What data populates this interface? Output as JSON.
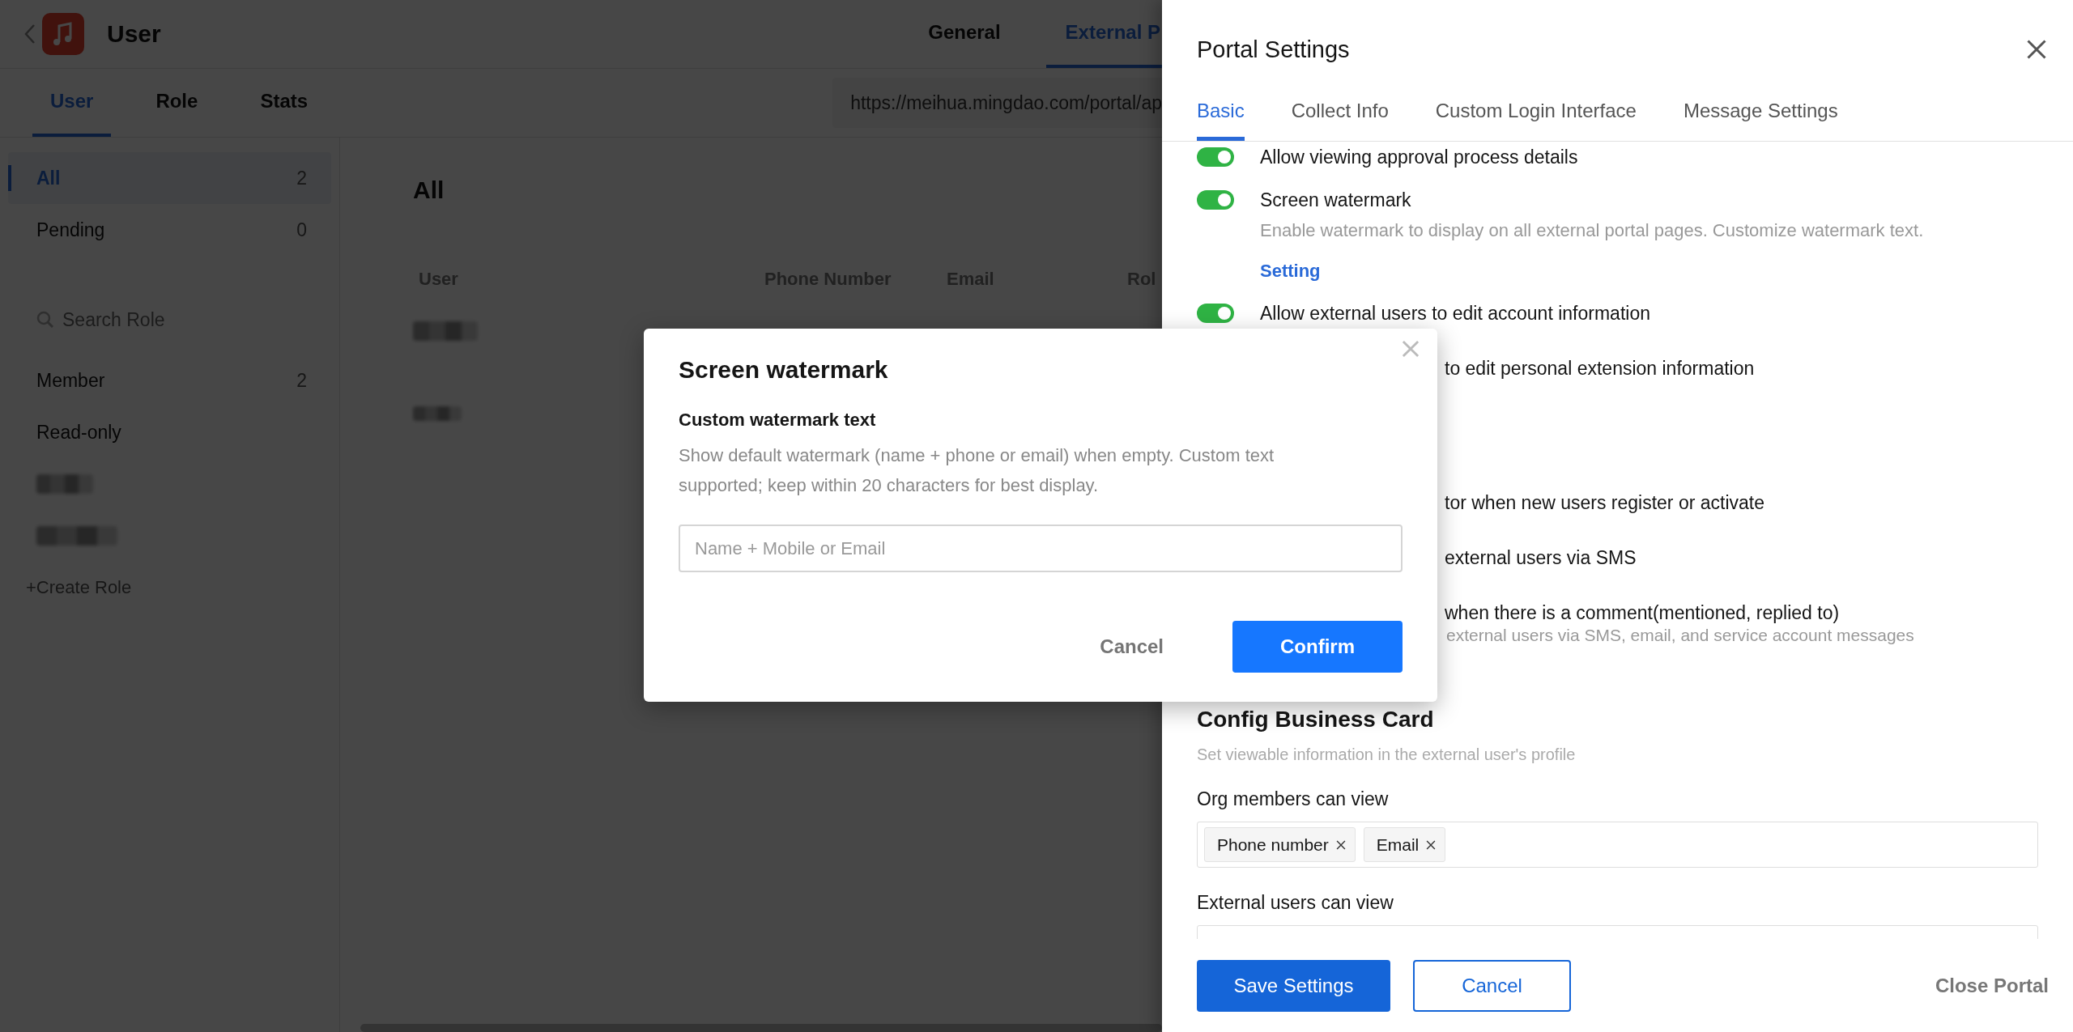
{
  "app": {
    "title": "User",
    "top_tabs": [
      {
        "label": "General",
        "selected": false
      },
      {
        "label": "External P",
        "selected": true
      }
    ],
    "sub_tabs": [
      {
        "label": "User",
        "selected": true
      },
      {
        "label": "Role",
        "selected": false
      },
      {
        "label": "Stats",
        "selected": false
      }
    ],
    "portal_url": "https://meihua.mingdao.com/portal/ap",
    "sidebar": {
      "filters": [
        {
          "label": "All",
          "count": "2",
          "selected": true
        },
        {
          "label": "Pending",
          "count": "0",
          "selected": false
        }
      ],
      "search": {
        "placeholder": "Search Role"
      },
      "roles": [
        {
          "kind": "text",
          "label": "Member",
          "count": "2"
        },
        {
          "kind": "text",
          "label": "Read-only"
        },
        {
          "kind": "redacted"
        },
        {
          "kind": "redacted"
        }
      ],
      "create_role": "+Create Role"
    },
    "main": {
      "heading": "All",
      "columns": [
        "User",
        "Phone Number",
        "Email",
        "Rol"
      ],
      "rows": [
        {
          "kind": "redacted"
        },
        {
          "kind": "redacted"
        }
      ]
    }
  },
  "drawer": {
    "title": "Portal Settings",
    "tabs": [
      {
        "label": "Basic",
        "selected": true
      },
      {
        "label": "Collect Info",
        "selected": false
      },
      {
        "label": "Custom Login Interface",
        "selected": false
      },
      {
        "label": "Message Settings",
        "selected": false
      }
    ],
    "settings": [
      {
        "kind": "toggle",
        "label": "Allow viewing approval process details",
        "on": true
      },
      {
        "kind": "toggle",
        "label": "Screen watermark",
        "on": true,
        "description": "Enable watermark to display on all external portal pages. Customize watermark text.",
        "link": "Setting"
      },
      {
        "kind": "toggle",
        "label": "Allow external users to edit account information",
        "on": true
      },
      {
        "kind": "partial",
        "label": "to edit personal extension information"
      },
      {
        "kind": "partial",
        "label": "tor when new users register or activate"
      },
      {
        "kind": "partial",
        "label": "external users via SMS"
      },
      {
        "kind": "partial",
        "label": "when there is a comment(mentioned, replied to)",
        "description": "external users via SMS, email, and service account messages"
      }
    ],
    "business_card": {
      "title": "Config Business Card",
      "subtitle": "Set viewable information in the external user's profile",
      "fields": [
        {
          "label": "Org members can view",
          "tags": [
            "Phone number",
            "Email"
          ]
        },
        {
          "label": "External users can view"
        }
      ]
    },
    "buttons": {
      "save": "Save Settings",
      "cancel": "Cancel",
      "close_portal": "Close Portal"
    }
  },
  "modal": {
    "title": "Screen watermark",
    "field_label": "Custom watermark text",
    "description": "Show default watermark (name + phone or email) when empty. Custom text supported; keep within 20 characters for best display.",
    "input": {
      "placeholder": "Name + Mobile or Email"
    },
    "buttons": {
      "cancel": "Cancel",
      "confirm": "Confirm"
    }
  }
}
